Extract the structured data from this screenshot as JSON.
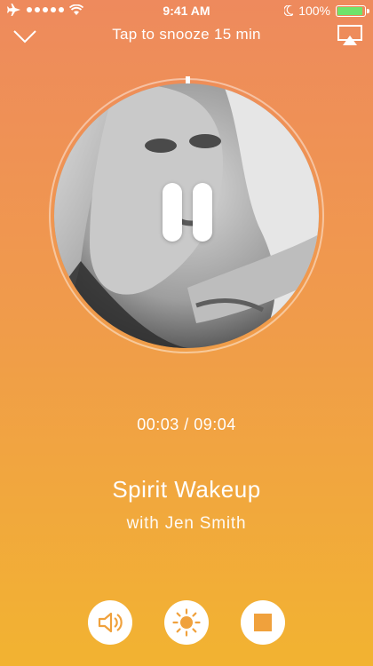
{
  "status_bar": {
    "time": "9:41 AM",
    "battery": "100%",
    "airplane_icon": "airplane-icon",
    "wifi_icon": "wifi-icon",
    "moon_icon": "moon-icon",
    "signal_dots": 5
  },
  "header": {
    "snooze_label": "Tap to snooze 15 min",
    "collapse_icon": "chevron-down-icon",
    "airplay_icon": "airplay-icon"
  },
  "player": {
    "elapsed": "00:03",
    "duration": "09:04",
    "time_display": "00:03 / 09:04",
    "title": "Spirit Wakeup",
    "subtitle": "with Jen Smith",
    "pause_icon": "pause-icon",
    "progress_fraction": 0.0055
  },
  "controls": [
    {
      "name": "volume-button",
      "icon": "speaker-icon"
    },
    {
      "name": "brightness-button",
      "icon": "sun-icon"
    },
    {
      "name": "stop-button",
      "icon": "stop-icon"
    }
  ],
  "colors": {
    "gradient_top": "#EE8A5D",
    "gradient_bottom": "#F2B331",
    "accent": "#F0A13C",
    "battery_green": "#6FE36A"
  }
}
